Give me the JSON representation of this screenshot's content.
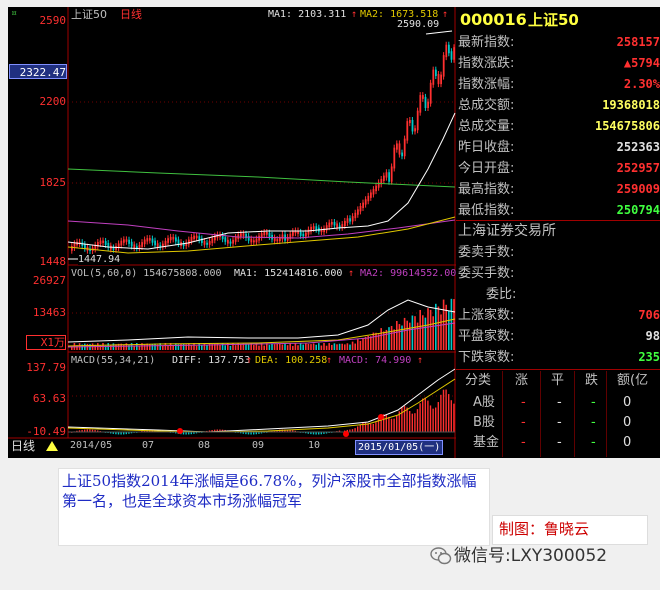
{
  "chart": {
    "index_name": "上证50",
    "period": "日线",
    "ma_header": {
      "ma1": "MA1: 2103.311",
      "ma2": "MA2: 1673.518"
    },
    "high_label": "2590.09",
    "low_label": "1447.94",
    "y_labels": {
      "p2590": "2590",
      "p2322": "2322.47",
      "p2200": "2200",
      "p1825": "1825",
      "p1448": "1448"
    },
    "vol_header": {
      "vol": "VOL(5,60,0) 154675808.000",
      "ma1": "MA1: 152414816.000",
      "ma2": "MA2: 99614552.00"
    },
    "vol_y_labels": {
      "top": "26927",
      "mid": "13463",
      "unit": "X1万"
    },
    "macd_header": {
      "params": "MACD(55,34,21)",
      "diff": "DIFF: 137.753",
      "dea": "DEA: 100.258",
      "macd": "MACD: 74.990"
    },
    "macd_y_labels": {
      "top": "137.79",
      "mid": "63.63",
      "bottom": "-10.49"
    },
    "x_ticks": {
      "t0": "2014/05",
      "t1": "07",
      "t2": "08",
      "t3": "09",
      "t4": "10"
    },
    "x_cursor_date": "2015/01/05(一)",
    "bottom_period": "日线",
    "colors": {
      "up": "#ff3030",
      "down": "#00c8c8",
      "ma_white": "#ffffff",
      "ma_green": "#40c040",
      "ma_purple": "#c040c0",
      "ma_yellow": "#e0c800"
    }
  },
  "info": {
    "code": "000016",
    "name": "上证50",
    "rows": [
      {
        "label": "最新指数:",
        "value": "258157",
        "color": "#ff3030"
      },
      {
        "label": "指数涨跌:",
        "value": "▲5794",
        "color": "#ff3030"
      },
      {
        "label": "指数涨幅:",
        "value": "2.30%",
        "color": "#ff3030"
      },
      {
        "label": "总成交额:",
        "value": "19368018",
        "color": "#ffff60"
      },
      {
        "label": "总成交量:",
        "value": "154675806",
        "color": "#ffff60"
      },
      {
        "label": "昨日收盘:",
        "value": "252363",
        "color": "#e0e0e0"
      },
      {
        "label": "今日开盘:",
        "value": "252957",
        "color": "#ff3030"
      },
      {
        "label": "最高指数:",
        "value": "259009",
        "color": "#ff3030"
      },
      {
        "label": "最低指数:",
        "value": "250794",
        "color": "#40ff40"
      }
    ],
    "exchange": "上海证券交易所",
    "rows2": [
      {
        "label": "委卖手数:",
        "value": "",
        "color": "#e0e0e0"
      },
      {
        "label": "委买手数:",
        "value": "",
        "color": "#e0e0e0"
      },
      {
        "label": "委比:",
        "value": "",
        "color": "#e0e0e0"
      },
      {
        "label": "上涨家数:",
        "value": "706",
        "color": "#ff3030"
      },
      {
        "label": "平盘家数:",
        "value": "98",
        "color": "#e0e0e0"
      },
      {
        "label": "下跌家数:",
        "value": "235",
        "color": "#40ff40"
      }
    ],
    "breadth_table": {
      "headers": [
        "分类",
        "涨",
        "平",
        "跌",
        "额(亿"
      ],
      "rows": [
        {
          "name": "A股",
          "up": "-",
          "flat": "-",
          "down": "-",
          "amt": "0"
        },
        {
          "name": "B股",
          "up": "-",
          "flat": "-",
          "down": "-",
          "amt": "0"
        },
        {
          "name": "基金",
          "up": "-",
          "flat": "-",
          "down": "-",
          "amt": "0"
        }
      ]
    }
  },
  "caption": "上证50指数2014年涨幅是66.78%，列沪深股市全部指数涨幅第一名，也是全球资本市场涨幅冠军",
  "credit": "制图：鲁晓云",
  "wechat": "微信号:LXY300052"
}
